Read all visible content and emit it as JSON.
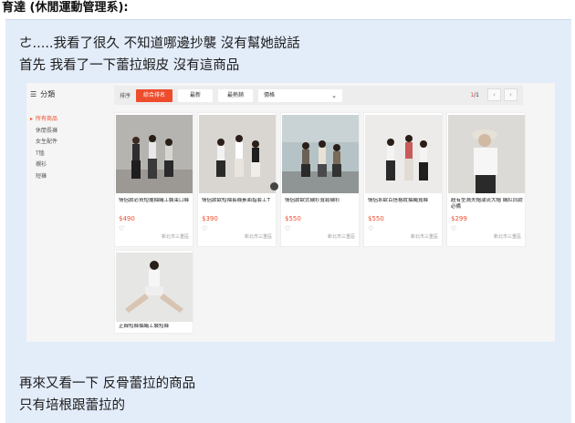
{
  "post": {
    "author": "育達 (休閒運動管理系):",
    "lines": [
      "ㄜ.....我看了很久 不知道哪邊抄襲 沒有幫她說話",
      "首先 我看了一下蕾拉蝦皮 沒有這商品",
      "再來又看一下 反骨蕾拉的商品",
      "只有培根跟蕾拉的"
    ]
  },
  "shop": {
    "sidebar_title": "分類",
    "sidebar_icon": "list-icon",
    "categories": [
      "所有商品",
      "休閒長褲",
      "女生配件",
      "T恤",
      "襯衫",
      "短褲"
    ],
    "sort_label": "排序",
    "sort_buttons": [
      "綜合排名",
      "最新",
      "最熱銷"
    ],
    "sort_select": "價格",
    "pager": {
      "current": "1",
      "total": "/1"
    },
    "accent": "#ee4d2d",
    "products": [
      {
        "name": "情侶款必買短擺抽繩工裝束口褲",
        "price": "$490",
        "location": "新北市三重區"
      },
      {
        "name": "情侶款歐短袖長襪素面指套工T",
        "price": "$390",
        "location": "新北市三重區"
      },
      {
        "name": "情侶款歐式襯衫寬鬆襯衫",
        "price": "$550",
        "location": "新北市三重區"
      },
      {
        "name": "情侶系歐百搭格紋抽繩寬褲",
        "price": "$550",
        "location": "新北市三重區"
      },
      {
        "name": "超有型漁夫帽潮流大帽 網紅同款必備",
        "price": "$299",
        "location": "新北市三重區"
      },
      {
        "name": "正韓短褲抽繩工裝短褲",
        "price": "",
        "location": ""
      }
    ]
  }
}
